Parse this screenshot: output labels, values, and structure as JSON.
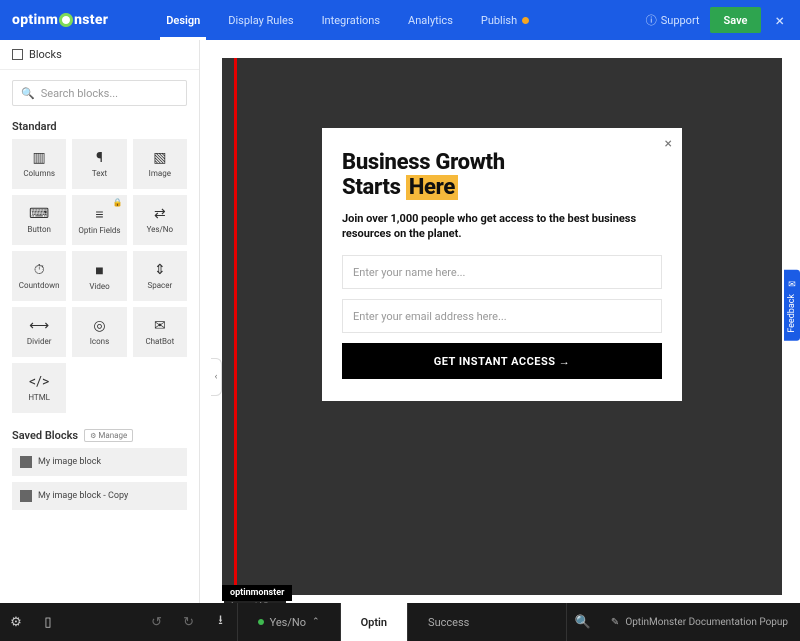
{
  "brand": "optinmonster",
  "topnav": {
    "tabs": [
      "Design",
      "Display Rules",
      "Integrations",
      "Analytics",
      "Publish"
    ],
    "active": 0,
    "support": "Support",
    "save": "Save"
  },
  "sidebar": {
    "blocks_label": "Blocks",
    "search_placeholder": "Search blocks...",
    "standard_label": "Standard",
    "blocks": [
      {
        "name": "Columns",
        "icon": "▥"
      },
      {
        "name": "Text",
        "icon": "¶"
      },
      {
        "name": "Image",
        "icon": "▧"
      },
      {
        "name": "Button",
        "icon": "⌨"
      },
      {
        "name": "Optin Fields",
        "icon": "≡",
        "locked": true
      },
      {
        "name": "Yes/No",
        "icon": "⇄"
      },
      {
        "name": "Countdown",
        "icon": "⏱"
      },
      {
        "name": "Video",
        "icon": "■"
      },
      {
        "name": "Spacer",
        "icon": "⇕"
      },
      {
        "name": "Divider",
        "icon": "⟷"
      },
      {
        "name": "Icons",
        "icon": "◎"
      },
      {
        "name": "ChatBot",
        "icon": "✉"
      },
      {
        "name": "HTML",
        "icon": "</>"
      }
    ],
    "saved_label": "Saved Blocks",
    "manage_label": "Manage",
    "saved": [
      "My image block",
      "My image block - Copy"
    ]
  },
  "popup": {
    "title_line1": "Business Growth",
    "title_line2a": "Starts ",
    "title_highlight": "Here",
    "subtitle": "Join over 1,000 people who get access to the best business resources on the planet.",
    "name_placeholder": "Enter your name here...",
    "email_placeholder": "Enter your email address here...",
    "cta": "GET INSTANT ACCESS →"
  },
  "tooltip_import": "Import View",
  "feedback_label": "Feedback",
  "bottombar": {
    "yesno": "Yes/No",
    "optin": "Optin",
    "success": "Success",
    "campaign": "OptinMonster Documentation Popup"
  }
}
